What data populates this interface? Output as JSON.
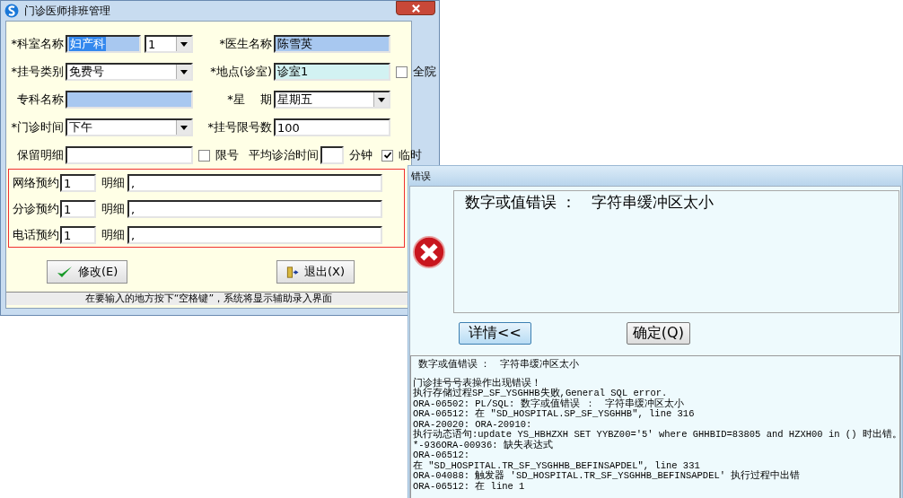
{
  "main_window": {
    "title": "门诊医师排班管理",
    "rows": [
      [
        {
          "kind": "label",
          "text": "*科室名称"
        },
        {
          "kind": "group",
          "items": [
            {
              "kind": "input",
              "value": "妇产科",
              "color": "#a8c8f0",
              "focused": true
            },
            {
              "kind": "combo",
              "value": "1"
            }
          ]
        },
        {
          "kind": "label",
          "text": "*医生名称"
        },
        {
          "kind": "input",
          "value": "陈雪英",
          "color": "#a8c8f0"
        }
      ],
      [
        {
          "kind": "label",
          "text": "*挂号类别"
        },
        {
          "kind": "combo",
          "value": "免费号"
        },
        {
          "kind": "label",
          "text": "*地点(诊室)"
        },
        {
          "kind": "input",
          "value": "诊室1",
          "color": "#d2f2f2"
        },
        {
          "kind": "checkbox",
          "text": "全院",
          "checked": false
        }
      ],
      [
        {
          "kind": "label",
          "text": "专科名称"
        },
        {
          "kind": "input",
          "color": "#a8c8f0"
        },
        {
          "kind": "label",
          "text": "*星　 期"
        },
        {
          "kind": "combo",
          "value": "星期五"
        }
      ],
      [
        {
          "kind": "label",
          "text": "*门诊时间"
        },
        {
          "kind": "combo",
          "value": "下午"
        },
        {
          "kind": "label",
          "text": "*挂号限号数"
        },
        {
          "kind": "input",
          "value": "100",
          "color": "#ffffff"
        }
      ],
      [
        {
          "kind": "label",
          "text": "保留明细"
        },
        {
          "kind": "input",
          "color": "#ffffff"
        },
        {
          "kind": "checkbox",
          "text": "限号",
          "checked": false
        },
        {
          "kind": "group",
          "items": [
            {
              "kind": "label",
              "text": "平均诊治时间"
            },
            {
              "kind": "input",
              "color": "#ffffff"
            },
            {
              "kind": "label",
              "text": "分钟"
            }
          ]
        },
        {
          "kind": "checkbox",
          "text": "临时",
          "checked": true
        }
      ]
    ],
    "bookings": [
      {
        "label": "网络预约",
        "count": "1",
        "detail_label": "明细",
        "detail": ","
      },
      {
        "label": "分诊预约",
        "count": "1",
        "detail_label": "明细",
        "detail": ","
      },
      {
        "label": "电话预约",
        "count": "1",
        "detail_label": "明细",
        "detail": ","
      }
    ],
    "buttons": [
      {
        "kind": "check",
        "label": "修改(E)"
      },
      {
        "kind": "exit",
        "label": "退出(X)"
      }
    ],
    "status_bar": "在要输入的地方按下“空格键”，系统将显示辅助录入界面"
  },
  "error_dialog": {
    "title": "错误",
    "message": "数字或值错误 ：　字符串缓冲区太小",
    "buttons": [
      {
        "label": "详情<<",
        "focused": true
      },
      {
        "label": "确定(Q)",
        "focused": false
      }
    ],
    "details": {
      "summary": "数字或值错误 ：　字符串缓冲区太小",
      "lines": [
        "门诊挂号号表操作出现错误！",
        "执行存储过程SP_SF_YSGHHB失败,General SQL error.",
        "ORA-06502: PL/SQL: 数字或值错误 ：　字符串缓冲区太小",
        "ORA-06512: 在 \"SD_HOSPITAL.SP_SF_YSGHHB\", line 316",
        "ORA-20020: ORA-20910:",
        "执行动态语句:update YS_HBHZXH SET YYBZ00='5' where GHHBID=83805 and HZXH00 in () 时出错。",
        "*-936ORA-00936: 缺失表达式",
        "ORA-06512:",
        "在 \"SD_HOSPITAL.TR_SF_YSGHHB_BEFINSAPDEL\", line 331",
        "ORA-04088: 触发器 'SD_HOSPITAL.TR_SF_YSGHHB_BEFINSAPDEL' 执行过程中出错",
        "ORA-06512: 在 line 1"
      ]
    }
  }
}
